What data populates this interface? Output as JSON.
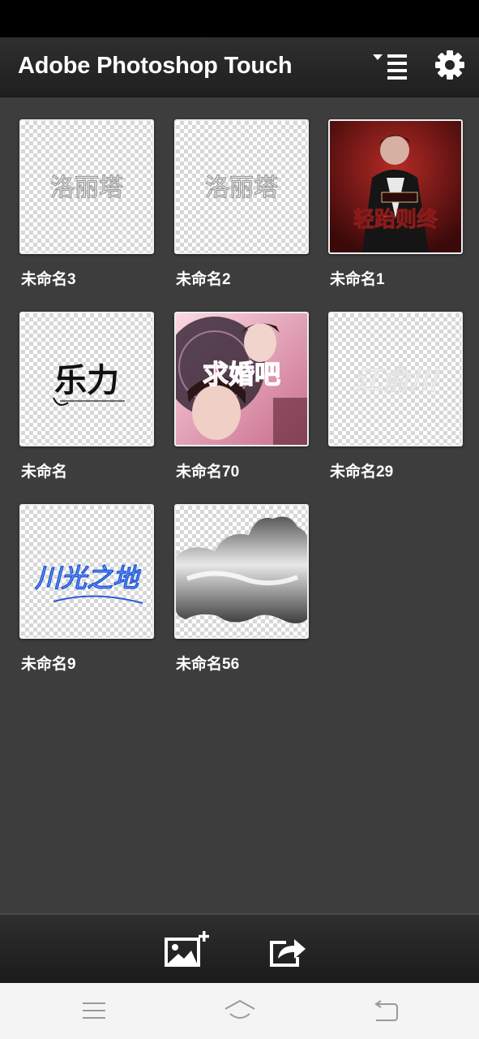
{
  "app_bar": {
    "title": "Adobe Photoshop Touch",
    "sort_icon": "sort-list-icon",
    "settings_icon": "gear-icon"
  },
  "projects": [
    {
      "name": "未命名3",
      "thumbnail_text": "洛丽塔"
    },
    {
      "name": "未命名2",
      "thumbnail_text": "洛丽塔"
    },
    {
      "name": "未命名1",
      "thumbnail_text": "轻跆则终"
    },
    {
      "name": "未命名",
      "thumbnail_text": "乐力"
    },
    {
      "name": "未命名70",
      "thumbnail_text": "求婚吧"
    },
    {
      "name": "未命名29",
      "thumbnail_text": "江俞川"
    },
    {
      "name": "未命名9",
      "thumbnail_text": "川光之地"
    },
    {
      "name": "未命名56",
      "thumbnail_text": ""
    }
  ],
  "bottom_bar": {
    "new_project_icon": "add-image-icon",
    "share_icon": "share-icon"
  },
  "nav_bar": {
    "menu_icon": "menu-icon",
    "home_icon": "home-icon",
    "back_icon": "back-icon"
  },
  "colors": {
    "background": "#3d3d3d",
    "app_bar": "#262626",
    "label": "#ffffff"
  }
}
